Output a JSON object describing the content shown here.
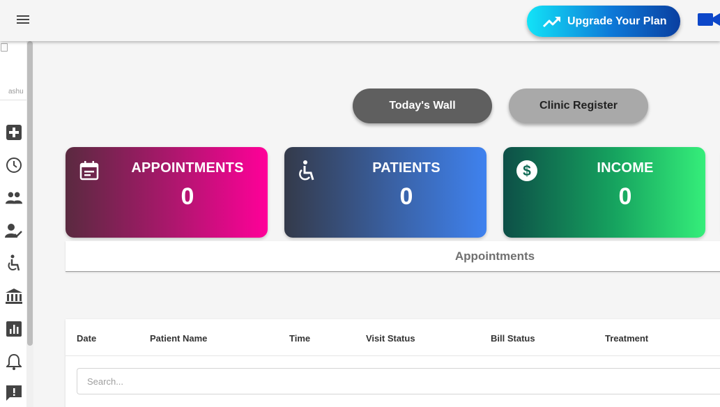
{
  "header": {
    "upgrade_label": "Upgrade Your Plan"
  },
  "sidebar": {
    "user_name": "ashu",
    "items": [
      {
        "icon": "medical-cross-icon"
      },
      {
        "icon": "clock-icon"
      },
      {
        "icon": "people-icon"
      },
      {
        "icon": "user-check-icon"
      },
      {
        "icon": "wheelchair-icon"
      },
      {
        "icon": "bank-icon"
      },
      {
        "icon": "bar-chart-icon"
      },
      {
        "icon": "bell-icon"
      },
      {
        "icon": "feedback-icon"
      }
    ]
  },
  "actions": {
    "todays_wall": "Today's Wall",
    "clinic_register": "Clinic Register"
  },
  "cards": {
    "appointments": {
      "title": "APPOINTMENTS",
      "value": "0",
      "icon": "calendar-icon"
    },
    "patients": {
      "title": "PATIENTS",
      "value": "0",
      "icon": "wheelchair-icon"
    },
    "income": {
      "title": "INCOME",
      "value": "0",
      "icon": "dollar-icon"
    }
  },
  "section": {
    "tab_label": "Appointments"
  },
  "table": {
    "columns": [
      "Date",
      "Patient Name",
      "Time",
      "Visit Status",
      "Bill Status",
      "Treatment"
    ],
    "search_placeholder": "Search..."
  },
  "colors": {
    "upgrade_gradient": [
      "#12e3f7",
      "#0a3fa0"
    ],
    "appointments_gradient": [
      "#5a2a40",
      "#ff0099"
    ],
    "patients_gradient": [
      "#343a4a",
      "#3f82ef"
    ],
    "income_gradient": [
      "#0d4f47",
      "#35ee7a"
    ],
    "wall_button": "#5f5f5f",
    "clinic_button": "#a9a9a9"
  }
}
